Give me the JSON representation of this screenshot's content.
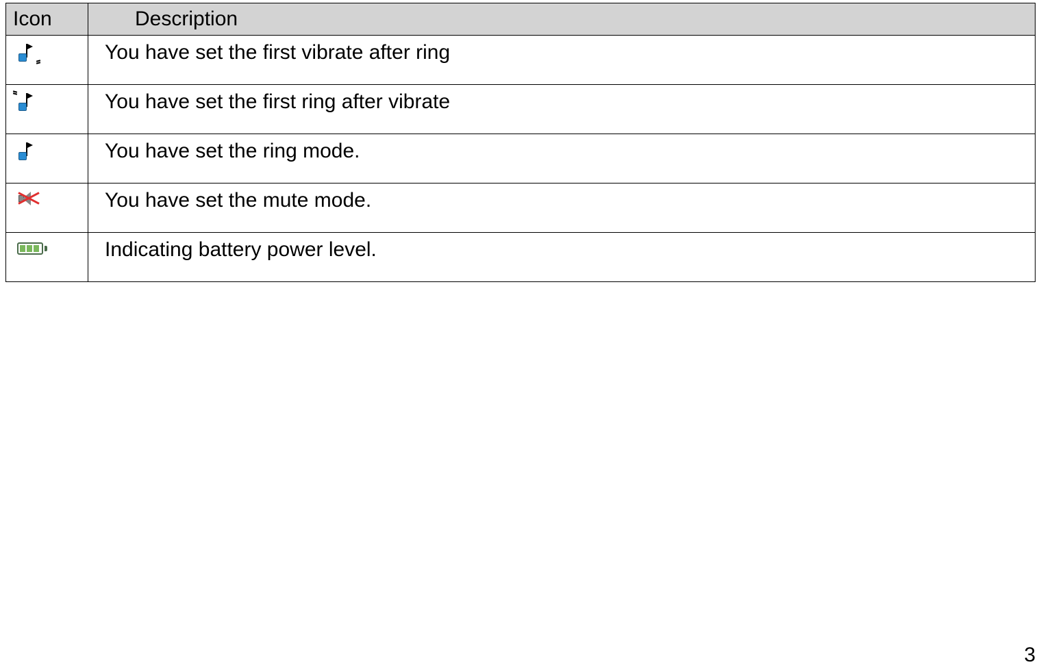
{
  "table": {
    "headers": {
      "icon": "Icon",
      "description": "Description"
    },
    "rows": [
      {
        "icon": "vibrate-after-ring-icon",
        "description": "You have set the first vibrate after ring"
      },
      {
        "icon": "ring-after-vibrate-icon",
        "description": "You have set the first ring after vibrate"
      },
      {
        "icon": "ring-mode-icon",
        "description": "You have set the ring mode."
      },
      {
        "icon": "mute-mode-icon",
        "description": "You have set the mute mode."
      },
      {
        "icon": "battery-level-icon",
        "description": "Indicating battery power level."
      }
    ]
  },
  "page_number": "3"
}
